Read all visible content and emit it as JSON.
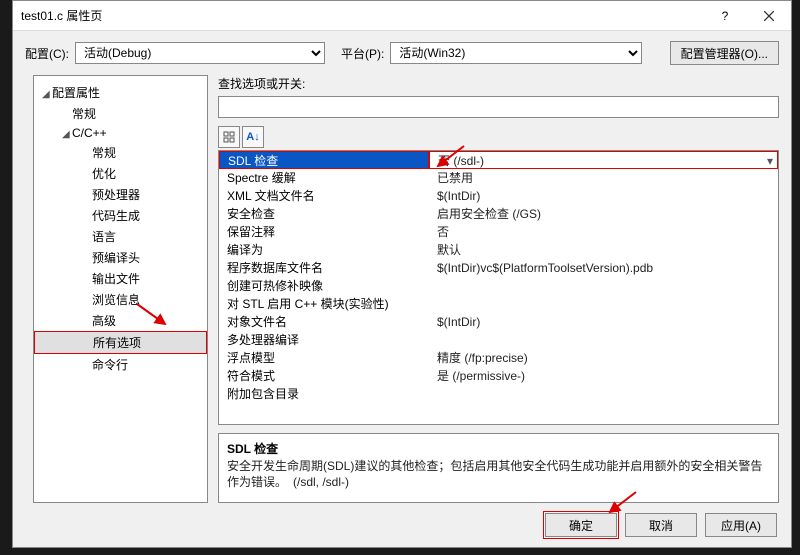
{
  "window": {
    "title": "test01.c 属性页"
  },
  "topbar": {
    "config_label": "配置(C):",
    "config_value": "活动(Debug)",
    "platform_label": "平台(P):",
    "platform_value": "活动(Win32)",
    "config_mgr": "配置管理器(O)..."
  },
  "tree": [
    {
      "label": "配置属性",
      "depth": 0,
      "exp": true
    },
    {
      "label": "常规",
      "depth": 1
    },
    {
      "label": "C/C++",
      "depth": 1,
      "exp": true
    },
    {
      "label": "常规",
      "depth": 2
    },
    {
      "label": "优化",
      "depth": 2
    },
    {
      "label": "预处理器",
      "depth": 2
    },
    {
      "label": "代码生成",
      "depth": 2
    },
    {
      "label": "语言",
      "depth": 2
    },
    {
      "label": "预编译头",
      "depth": 2
    },
    {
      "label": "输出文件",
      "depth": 2
    },
    {
      "label": "浏览信息",
      "depth": 2
    },
    {
      "label": "高级",
      "depth": 2
    },
    {
      "label": "所有选项",
      "depth": 2,
      "sel": true
    },
    {
      "label": "命令行",
      "depth": 2
    }
  ],
  "search": {
    "label": "查找选项或开关:",
    "value": ""
  },
  "grid": [
    {
      "k": "SDL 检查",
      "v": "否 (/sdl-)",
      "hl": true
    },
    {
      "k": "Spectre 缓解",
      "v": "已禁用"
    },
    {
      "k": "XML 文档文件名",
      "v": "$(IntDir)"
    },
    {
      "k": "安全检查",
      "v": "启用安全检查 (/GS)"
    },
    {
      "k": "保留注释",
      "v": "否"
    },
    {
      "k": "编译为",
      "v": "默认"
    },
    {
      "k": "程序数据库文件名",
      "v": "$(IntDir)vc$(PlatformToolsetVersion).pdb"
    },
    {
      "k": "创建可热修补映像",
      "v": ""
    },
    {
      "k": "对 STL 启用 C++ 模块(实验性)",
      "v": ""
    },
    {
      "k": "对象文件名",
      "v": "$(IntDir)"
    },
    {
      "k": "多处理器编译",
      "v": ""
    },
    {
      "k": "浮点模型",
      "v": "精度 (/fp:precise)"
    },
    {
      "k": "符合模式",
      "v": "是 (/permissive-)"
    },
    {
      "k": "附加包含目录",
      "v": ""
    }
  ],
  "desc": {
    "title": "SDL 检查",
    "body": "安全开发生命周期(SDL)建议的其他检查；包括启用其他安全代码生成功能并启用额外的安全相关警告作为错误。　(/sdl, /sdl-)"
  },
  "footer": {
    "ok": "确定",
    "cancel": "取消",
    "apply": "应用(A)"
  }
}
